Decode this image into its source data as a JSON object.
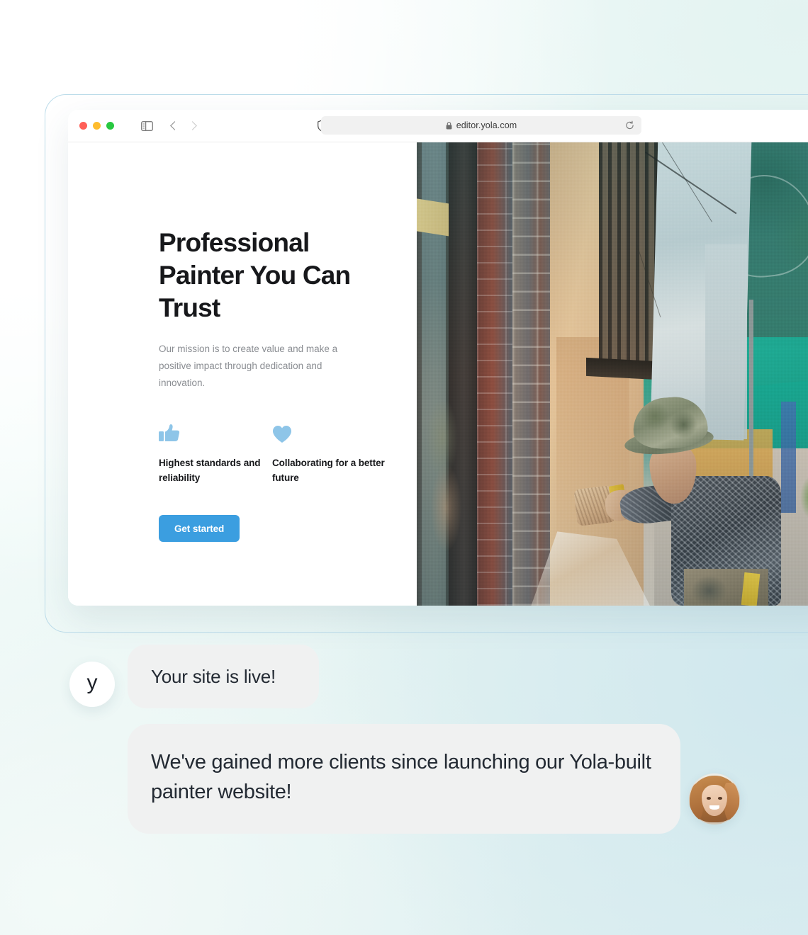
{
  "browser": {
    "traffic_lights": [
      "close",
      "minimize",
      "maximize"
    ],
    "url": "editor.yola.com",
    "lock_icon": "lock-icon",
    "reload_icon": "reload-icon",
    "sidebar_icon": "sidebar-toggle-icon",
    "back_icon": "back-chevron-icon",
    "forward_icon": "forward-chevron-icon",
    "shield_icon": "privacy-shield-icon"
  },
  "site": {
    "hero": {
      "title": "Professional Painter You Can Trust",
      "subtitle": "Our mission is to create value and make a positive impact through dedication and innovation.",
      "cta_label": "Get started"
    },
    "features": [
      {
        "icon": "thumbs-up-icon",
        "label": "Highest standards and reliability"
      },
      {
        "icon": "heart-icon",
        "label": "Collaborating for a better future"
      }
    ],
    "photo_alt": "painter applying paint to a wall with a roller"
  },
  "chat": {
    "brand_initial": "y",
    "messages": [
      {
        "from": "yola",
        "text": "Your site is live!"
      },
      {
        "from": "user",
        "text": "We've gained more clients since launching our Yola-built painter website!"
      }
    ],
    "user_avatar": "user-avatar-photo"
  },
  "colors": {
    "accent_blue": "#3b9ee0",
    "feature_icon_blue": "#8ec5e8",
    "bubble_gray": "#f0f1f1",
    "heading": "#17181b",
    "body_text": "#8a8d92",
    "frame_border": "#bcdcea"
  }
}
